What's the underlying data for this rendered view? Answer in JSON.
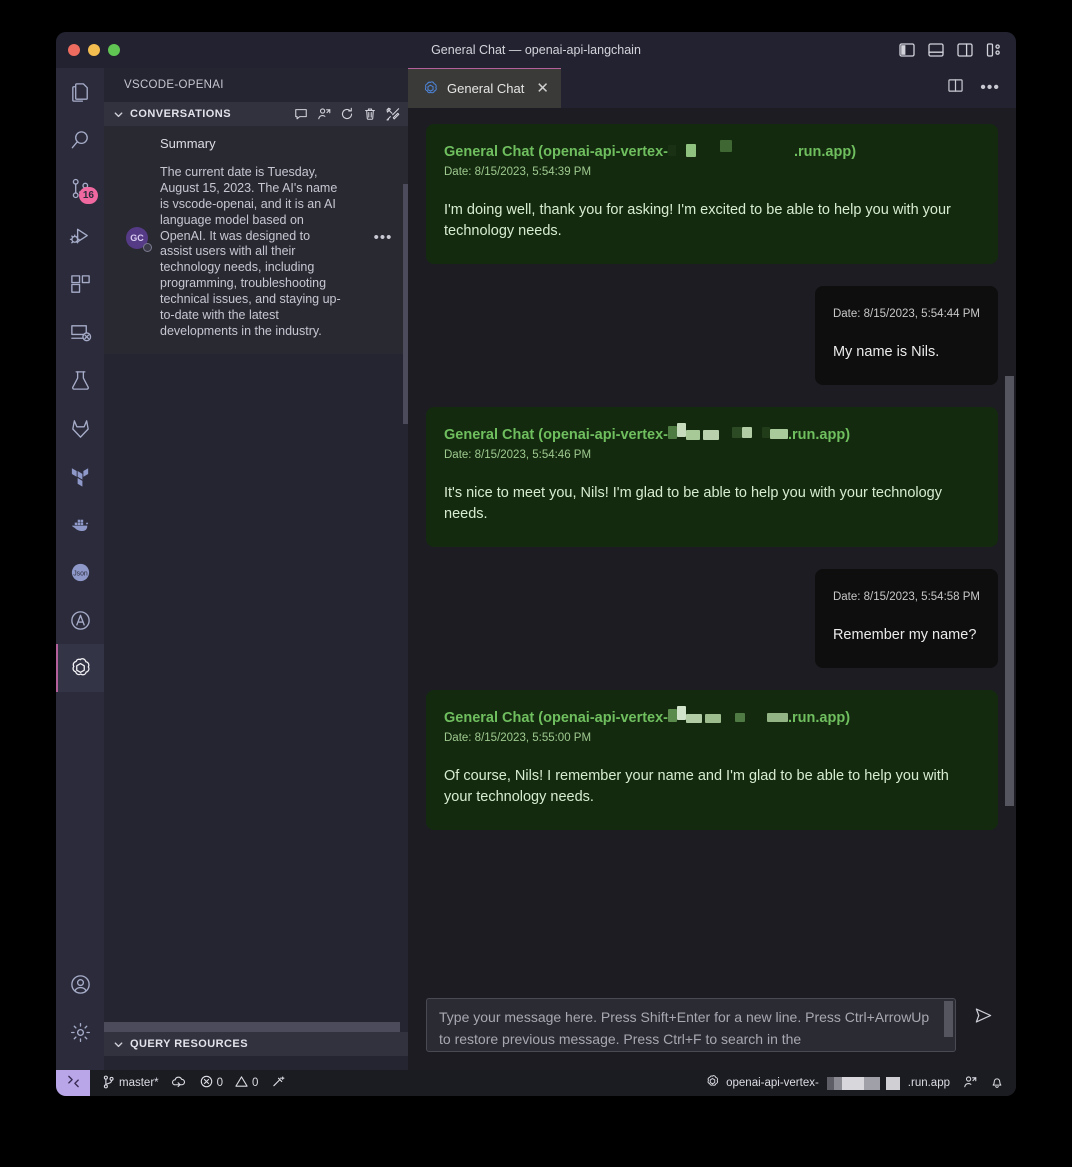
{
  "window": {
    "title": "General Chat — openai-api-langchain",
    "traffic_lights": [
      "close",
      "minimize",
      "maximize"
    ],
    "layout_icons": [
      "toggle-primary-sidebar-icon",
      "toggle-panel-icon",
      "toggle-secondary-sidebar-icon",
      "customize-layout-icon"
    ]
  },
  "activity_bar": {
    "items": [
      {
        "name": "explorer",
        "icon": "files-icon",
        "badge": null,
        "active": false
      },
      {
        "name": "search",
        "icon": "search-icon",
        "badge": null,
        "active": false
      },
      {
        "name": "source-control",
        "icon": "source-control-icon",
        "badge": "16",
        "active": false
      },
      {
        "name": "run-and-debug",
        "icon": "run-debug-icon",
        "badge": null,
        "active": false
      },
      {
        "name": "extensions",
        "icon": "extensions-icon",
        "badge": null,
        "active": false
      },
      {
        "name": "remote-explorer",
        "icon": "remote-explorer-icon",
        "badge": null,
        "active": false
      },
      {
        "name": "testing",
        "icon": "beaker-icon",
        "badge": null,
        "active": false
      },
      {
        "name": "gitlab",
        "icon": "gitlab-icon",
        "badge": null,
        "active": false
      },
      {
        "name": "terraform",
        "icon": "terraform-icon",
        "badge": null,
        "active": false
      },
      {
        "name": "docker",
        "icon": "docker-icon",
        "badge": null,
        "active": false
      },
      {
        "name": "json",
        "icon": "json-icon",
        "badge": null,
        "active": false
      },
      {
        "name": "ansible",
        "icon": "circle-a-icon",
        "badge": null,
        "active": false
      },
      {
        "name": "openai",
        "icon": "openai-icon",
        "badge": null,
        "active": true
      }
    ],
    "bottom_items": [
      {
        "name": "accounts",
        "icon": "account-icon"
      },
      {
        "name": "manage",
        "icon": "gear-icon"
      }
    ]
  },
  "sidebar": {
    "workspace_title": "VSCODE-OPENAI",
    "sections": [
      {
        "label": "CONVERSATIONS",
        "expanded": true,
        "actions": [
          "new-conversation-icon",
          "new-persona-icon",
          "refresh-icon",
          "delete-icon",
          "tools-icon"
        ]
      },
      {
        "label": "QUERY RESOURCES",
        "expanded": true,
        "actions": []
      }
    ],
    "conversation": {
      "avatar_initials": "GC",
      "name": "Summary",
      "snippet": "The current date is Tuesday, August 15, 2023. The AI's name is vscode-openai, and it is an AI language model based on OpenAI. It was designed to assist users with all their technology needs, including programming, troubleshooting technical issues, and staying up-to-date with the latest developments in the industry.",
      "more_label": "•••"
    }
  },
  "editor": {
    "tab": {
      "label": "General Chat",
      "icon": "openai-icon",
      "close_label": "✕",
      "active": true
    },
    "actions": [
      "split-editor-icon",
      "more-actions-icon"
    ],
    "more_label": "•••"
  },
  "chat": {
    "messages": [
      {
        "role": "assistant",
        "title_prefix": "General Chat (openai-api-vertex-",
        "title_suffix": ".run.app)",
        "date": "Date: 8/15/2023, 5:54:39 PM",
        "text": "I'm doing well, thank you for asking! I'm excited to be able to help you with your technology needs."
      },
      {
        "role": "user",
        "title_prefix": "",
        "title_suffix": "",
        "date": "Date: 8/15/2023, 5:54:44 PM",
        "text": "My name is Nils."
      },
      {
        "role": "assistant",
        "title_prefix": "General Chat (openai-api-vertex-",
        "title_suffix": ".run.app)",
        "date": "Date: 8/15/2023, 5:54:46 PM",
        "text": "It's nice to meet you, Nils! I'm glad to be able to help you with your technology needs."
      },
      {
        "role": "user",
        "title_prefix": "",
        "title_suffix": "",
        "date": "Date: 8/15/2023, 5:54:58 PM",
        "text": "Remember my name?"
      },
      {
        "role": "assistant",
        "title_prefix": "General Chat (openai-api-vertex-",
        "title_suffix": ".run.app)",
        "date": "Date: 8/15/2023, 5:55:00 PM",
        "text": "Of course, Nils! I remember your name and I'm glad to be able to help you with your technology needs."
      }
    ]
  },
  "composer": {
    "placeholder": "Type your message here. Press Shift+Enter for a new line. Press Ctrl+ArrowUp to restore previous message. Press Ctrl+F to search in the chat.",
    "visible_text": "Type your message here. Press Shift+Enter for a new line. Press Ctrl+ArrowUp to restore previous message. Press Ctrl+F to search in the",
    "send_icon": "send-icon"
  },
  "status_bar": {
    "remote_icon": "remote-window-icon",
    "branch": "master*",
    "sync_icon": "sync-cloud-icon",
    "errors": "0",
    "warnings": "0",
    "ports_icon": "ports-icon",
    "endpoint_prefix": "openai-api-vertex-",
    "endpoint_suffix": ".run.app",
    "endpoint_icon": "openai-icon",
    "right_icons": [
      "remote-account-icon",
      "bell-icon"
    ]
  },
  "colors": {
    "assistant_bubble": "#142a0f",
    "assistant_title": "#6fbf5f",
    "user_bubble": "#0e0e0e",
    "accent": "#b4609a",
    "badge": "#f068a0",
    "remote_indicator": "#b9a6e8"
  }
}
